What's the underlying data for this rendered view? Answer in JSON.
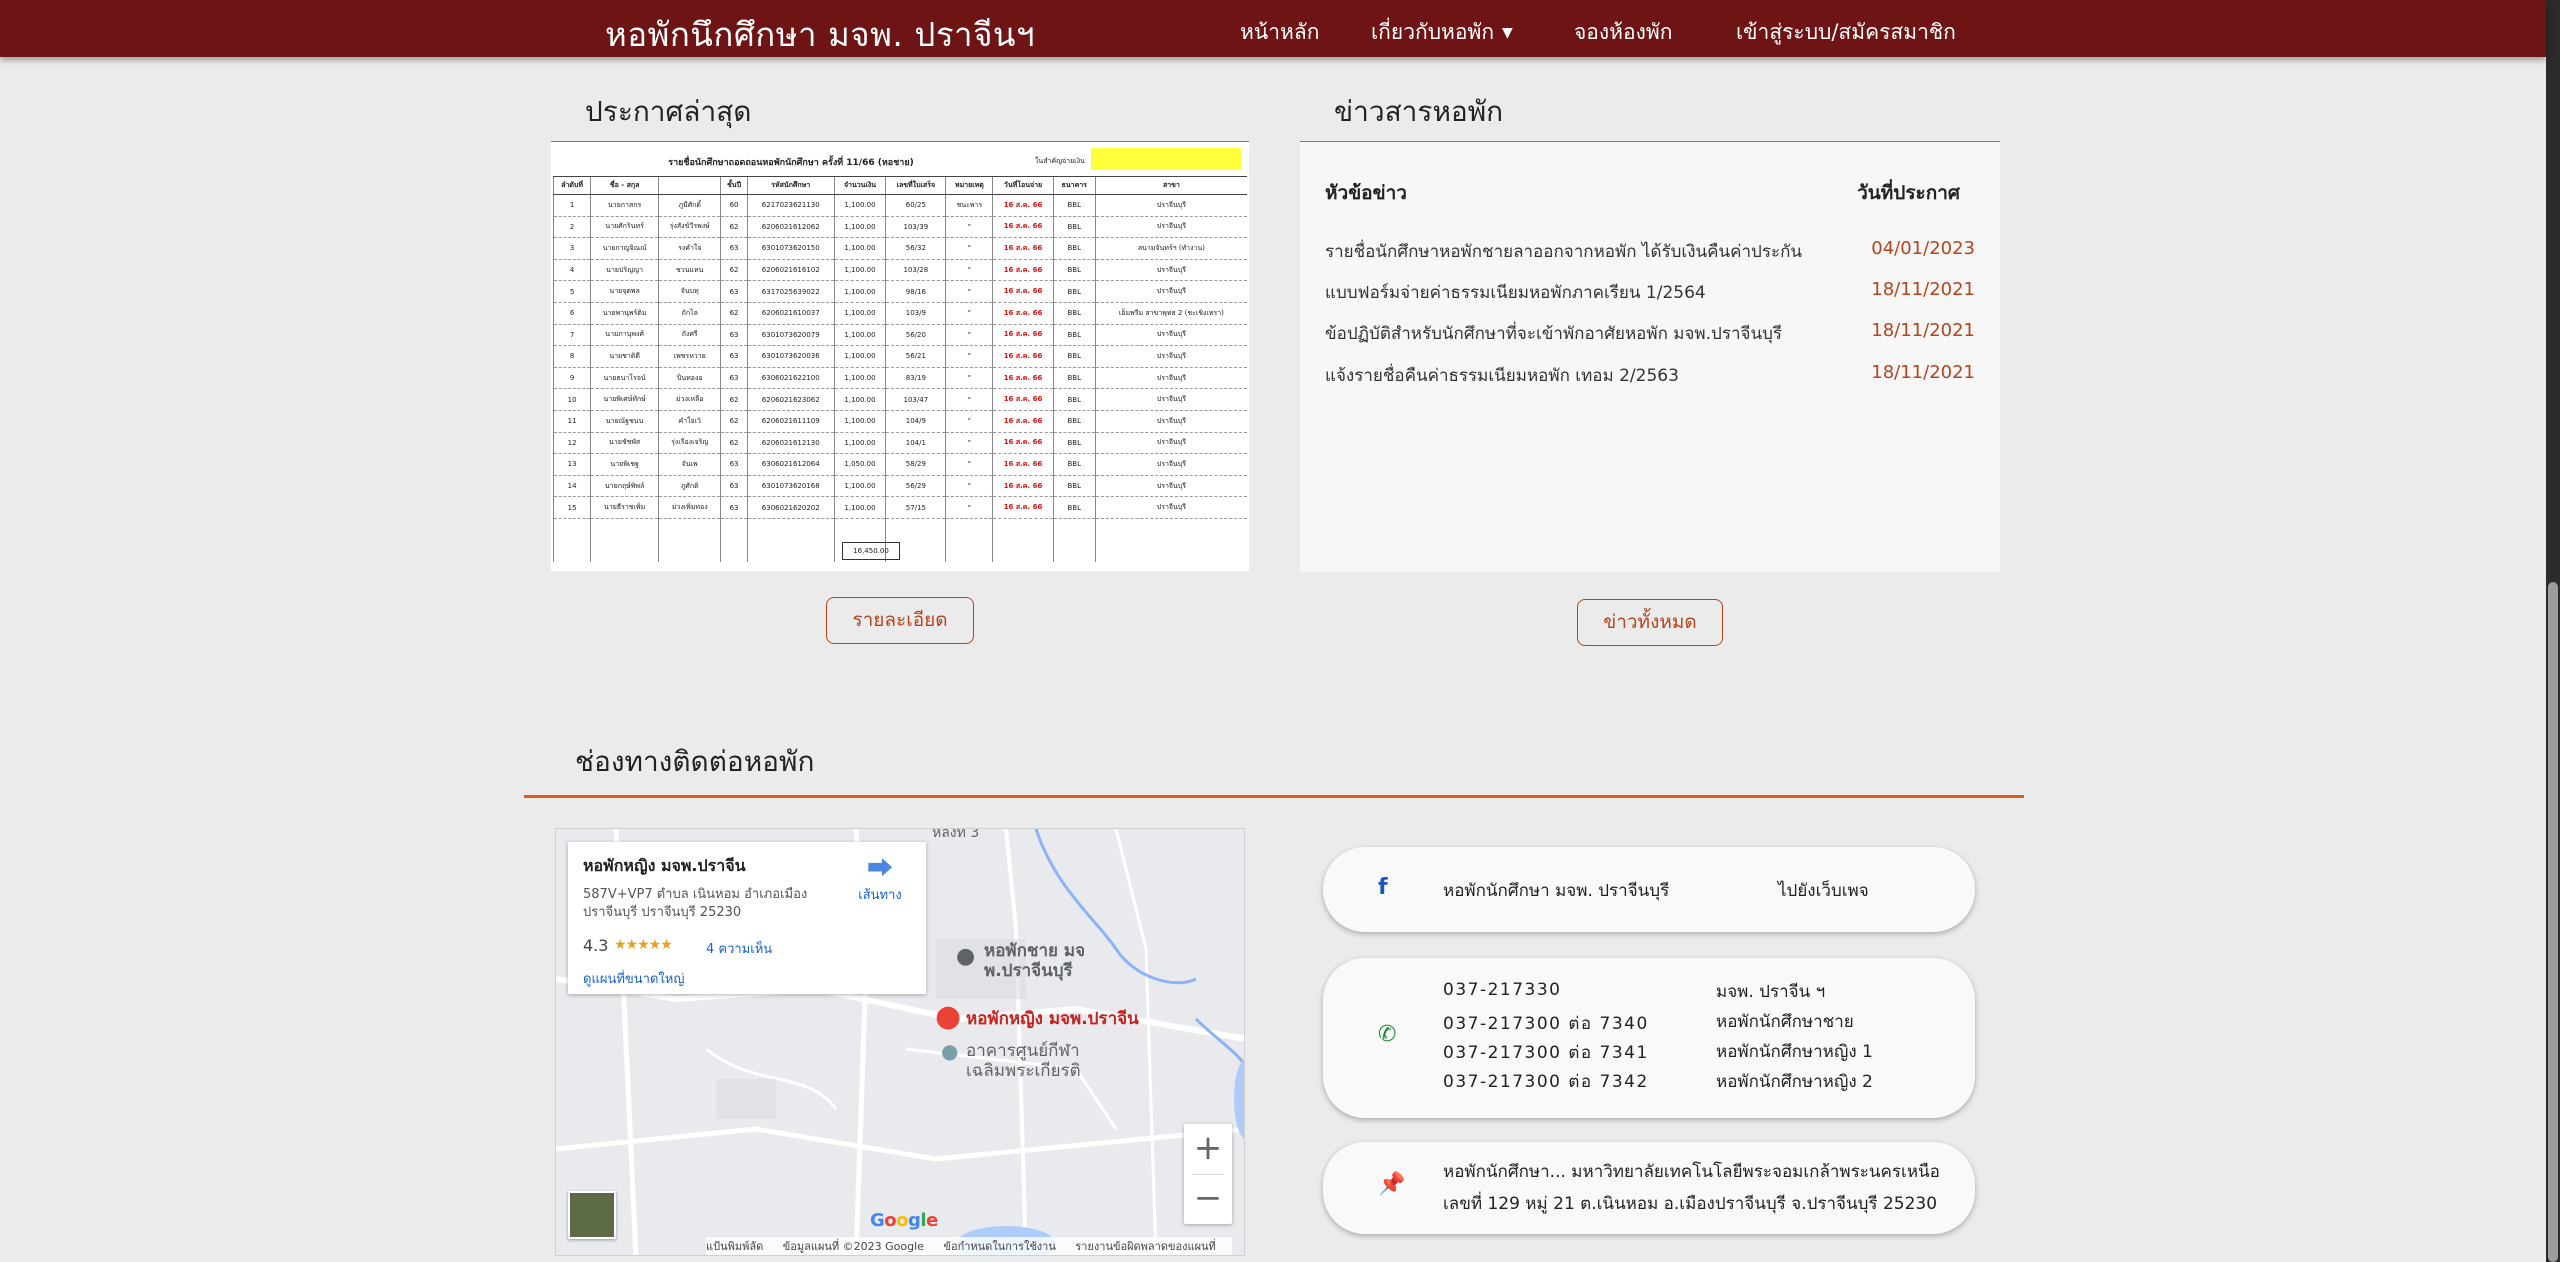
{
  "navbar": {
    "brand": "หอพักนึกศึกษา มจพ. ปราจีนฯ",
    "items": [
      "หน้าหลัก",
      "เกี่ยวกับหอพัก",
      "จองห้องพัก",
      "เข้าสู่ระบบ/สมัครสมาชิก"
    ]
  },
  "announcements": {
    "title": "ประกาศล่าสุด",
    "detail_button": "รายละเอียด",
    "sheet": {
      "title": "รายชื่อนักศึกษาถอดถอนหอพักนักศึกษา ครั้งที่ 11/66 (หอชาย)",
      "side_header": "ในสำคัญจ่ายเงิน",
      "headers": [
        "ลำดับที่",
        "ชื่อ - สกุล",
        "",
        "ชั้นปี",
        "รหัสนักศึกษา",
        "จำนวนเงิน",
        "เลขที่ใบเสร็จ",
        "หมายเหตุ",
        "วันที่โอนจ่าย",
        "ธนาคาร",
        "สาขา"
      ],
      "rows": [
        [
          "1",
          "นายกาสกร",
          "ภูมีศักดิ์",
          "60",
          "6217023621130",
          "1,100.00",
          "60/25",
          "ชนะพาร",
          "16 ส.ค. 66",
          "BBL",
          "ปราจีนบุรี"
        ],
        [
          "2",
          "นายศักรินทร์",
          "รุ่งสังข์วีรพงษ์",
          "62",
          "6206021612062",
          "1,100.00",
          "103/39",
          "\"",
          "16 ส.ค. 66",
          "BBL",
          "ปราจีนบุรี"
        ],
        [
          "3",
          "นายกาญจิณณ์",
          "รงคำใจ",
          "63",
          "6301073620150",
          "1,100.00",
          "56/32",
          "\"",
          "16 ส.ค. 66",
          "BBL",
          "สนามจันทร์ฯ (ทำงาน)"
        ],
        [
          "4",
          "นายปริญญา",
          "ชวนแทน",
          "62",
          "6206021616102",
          "1,100.00",
          "103/28",
          "\"",
          "16 ส.ค. 66",
          "BBL",
          "ปราจีนบุรี"
        ],
        [
          "5",
          "นายจุตพล",
          "จันบทุ",
          "63",
          "6317025639022",
          "1,100.00",
          "98/16",
          "\"",
          "16 ส.ค. 66",
          "BBL",
          "ปราจีนบุรี"
        ],
        [
          "6",
          "นายพานุพร์ติม",
          "ถักไล",
          "62",
          "6206021610037",
          "1,100.00",
          "103/9",
          "\"",
          "16 ส.ค. 66",
          "BBL",
          "เอ็มพรีม สาขาพุทธ 2 (ชะเชิงเทรา)"
        ],
        [
          "7",
          "นายภานุพงศ์",
          "ถังศรี",
          "63",
          "6301073620079",
          "1,100.00",
          "56/20",
          "\"",
          "16 ส.ค. 66",
          "BBL",
          "ปราจีนบุรี"
        ],
        [
          "8",
          "นายชาติดี",
          "เพชรหวาย",
          "63",
          "6301073620036",
          "1,100.00",
          "56/21",
          "\"",
          "16 ส.ค. 66",
          "BBL",
          "ปราจีนบุรี"
        ],
        [
          "9",
          "นายธนาโรจน์",
          "ปิ่นทองอ",
          "63",
          "6306021622100",
          "1,100.00",
          "83/19",
          "\"",
          "16 ส.ค. 66",
          "BBL",
          "ปราจีนบุรี"
        ],
        [
          "10",
          "นายพิเศษ์ทักษ์",
          "ม่วงเหลือ",
          "62",
          "6206021623062",
          "1,100.00",
          "103/47",
          "\"",
          "16 ส.ค. 66",
          "BBL",
          "ปราจีนบุรี"
        ],
        [
          "11",
          "นายณัฐชนน",
          "คำใจเวิ",
          "62",
          "6206021611109",
          "1,100.00",
          "104/9",
          "\"",
          "16 ส.ค. 66",
          "BBL",
          "ปราจีนบุรี"
        ],
        [
          "12",
          "นายชัชพัส",
          "รุ่งเรืองเจริญ",
          "62",
          "6206021612130",
          "1,100.00",
          "104/1",
          "\"",
          "16 ส.ค. 66",
          "BBL",
          "ปราจีนบุรี"
        ],
        [
          "13",
          "นายพิเชฐ",
          "จันเพ",
          "63",
          "6306021612064",
          "1,050.00",
          "58/29",
          "\"",
          "16 ส.ค. 66",
          "BBL",
          "ปราจีนบุรี"
        ],
        [
          "14",
          "นายกฤษ์พิพล์",
          "ภูศักดิ",
          "63",
          "6301073620168",
          "1,100.00",
          "56/29",
          "\"",
          "16 ส.ค. 66",
          "BBL",
          "ปราจีนบุรี"
        ],
        [
          "15",
          "นายธีราชเพิ่ม",
          "ม่วงเพิ่มทอง",
          "63",
          "6306021620202",
          "1,100.00",
          "57/15",
          "\"",
          "16 ส.ค. 66",
          "BBL",
          "ปราจีนบุรี"
        ]
      ],
      "total": "16,450.00"
    }
  },
  "news": {
    "title": "ข่าวสารหอพัก",
    "col_topic": "หัวข้อข่าว",
    "col_date": "วันที่ประกาศ",
    "all_button": "ข่าวทั้งหมด",
    "items": [
      {
        "topic": "รายชื่อนักศึกษาหอพักชายลาออกจากหอพัก ได้รับเงินคืนค่าประกัน",
        "date": "04/01/2023"
      },
      {
        "topic": "แบบฟอร์มจ่ายค่าธรรมเนียมหอพักภาคเรียน 1/2564",
        "date": "18/11/2021"
      },
      {
        "topic": "ข้อปฏิบัติสำหรับนักศึกษาที่จะเข้าพักอาศัยหอพัก มจพ.ปราจีนบุรี",
        "date": "18/11/2021"
      },
      {
        "topic": "แจ้งรายชื่อคืนค่าธรรมเนียมหอพัก เทอม 2/2563",
        "date": "18/11/2021"
      }
    ]
  },
  "contact": {
    "title": "ช่องทางติดต่อหอพัก",
    "map": {
      "place_name": "หอพักหญิง มจพ.ปราจีน",
      "address": "587V+VP7 ตำบล เนินหอม อำเภอเมือง ปราจีนบุรี ปราจีนบุรี 25230",
      "rating": "4.3",
      "stars": "★★★★★",
      "reviews": "4 ความเห็น",
      "directions": "เส้นทาง",
      "view_larger": "ดูแผนที่ขนาดใหญ่",
      "marker_label": "หอพักหญิง มจพ.ปราจีน",
      "poi_male_dorm": "หอพักชาย มจ\nพ.ปราจีนบุรี",
      "poi_sport": "อาคารศูนย์กีฬา\nเฉลิมพระเกียรติ",
      "road_label": "หลังที่ 3",
      "google": "Google",
      "attribution": [
        "แป้นพิมพ์ลัด",
        "ข้อมูลแผนที่ ©2023 Google",
        "ข้อกำหนดในการใช้งาน",
        "รายงานข้อผิดพลาดของแผนที่"
      ],
      "zoom_in": "+",
      "zoom_out": "−"
    },
    "facebook": {
      "name": "หอพักนักศึกษา มจพ. ปราจีนบุรี",
      "link": "ไปยังเว็บเพจ",
      "icon": "facebook-icon"
    },
    "phones": [
      {
        "number": "037-217330",
        "label": "มจพ. ปราจีน ฯ"
      },
      {
        "number": "037-217300 ต่อ 7340",
        "label": "หอพักนักศึกษาชาย"
      },
      {
        "number": "037-217300 ต่อ 7341",
        "label": "หอพักนักศึกษาหญิง 1"
      },
      {
        "number": "037-217300 ต่อ 7342",
        "label": "หอพักนักศึกษาหญิง 2"
      }
    ],
    "address": {
      "line1": "หอพักนักศึกษา... มหาวิทยาลัยเทคโนโลยีพระจอมเกล้าพระนครเหนือ",
      "line2": "เลขที่ 129 หมู่ 21 ต.เนินหอม อ.เมืองปราจีนบุรี จ.ปราจีนบุรี 25230"
    }
  },
  "colors": {
    "navbar": "#6e1414",
    "accent": "#dc5a1e",
    "link_date": "#b5441c",
    "background": "#ebebeb"
  }
}
